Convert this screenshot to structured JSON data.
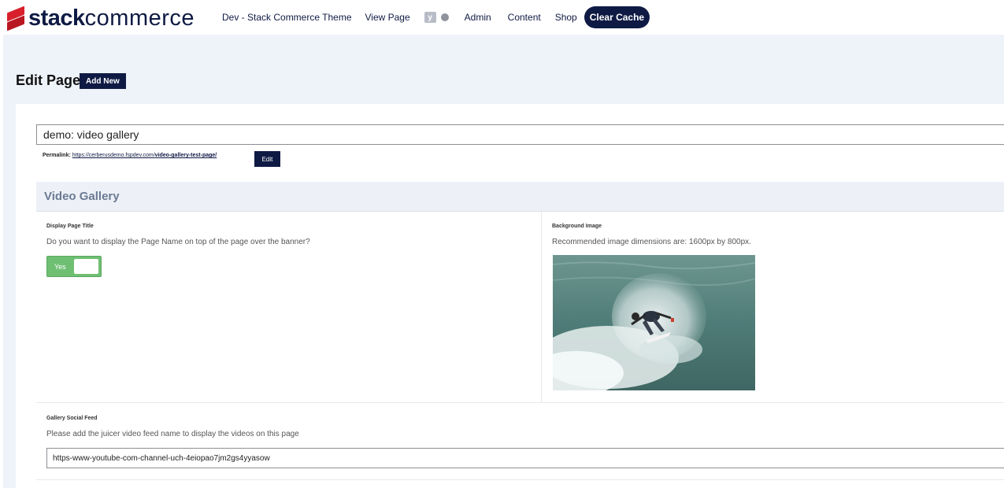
{
  "logo": {
    "stack": "stack",
    "commerce": "commerce"
  },
  "nav": {
    "theme": "Dev - Stack Commerce Theme",
    "view_page": "View Page",
    "yoast_icon": "y",
    "admin": "Admin",
    "content": "Content",
    "shop": "Shop",
    "clear_cache": "Clear Cache"
  },
  "page": {
    "title": "Edit Page",
    "add_new": "Add New"
  },
  "post_title": {
    "value": "demo: video gallery"
  },
  "permalink": {
    "label": "Permalink:",
    "base": "https://cerberusdemo.fspdev.com/",
    "slug": "video-gallery-test-page/",
    "edit": "Edit"
  },
  "section": {
    "title": "Video Gallery"
  },
  "display_title": {
    "label": "Display Page Title",
    "description": "Do you want to display the Page Name on top of the page over the banner?",
    "toggle_label": "Yes",
    "enabled": true
  },
  "background_image": {
    "label": "Background Image",
    "description": "Recommended image dimensions are: 1600px by 800px."
  },
  "social_feed": {
    "label": "Gallery Social Feed",
    "description": "Please add the juicer video feed name to display the videos on this page",
    "value": "https-www-youtube-com-channel-uch-4eiopao7jm2gs4yyasow"
  },
  "colors": {
    "brand_navy": "#0f1a44",
    "brand_red": "#d8202c",
    "toggle_green": "#6fbf73"
  },
  "icons": [
    "logo-mark-icon",
    "yoast-icon",
    "status-dot-icon"
  ]
}
